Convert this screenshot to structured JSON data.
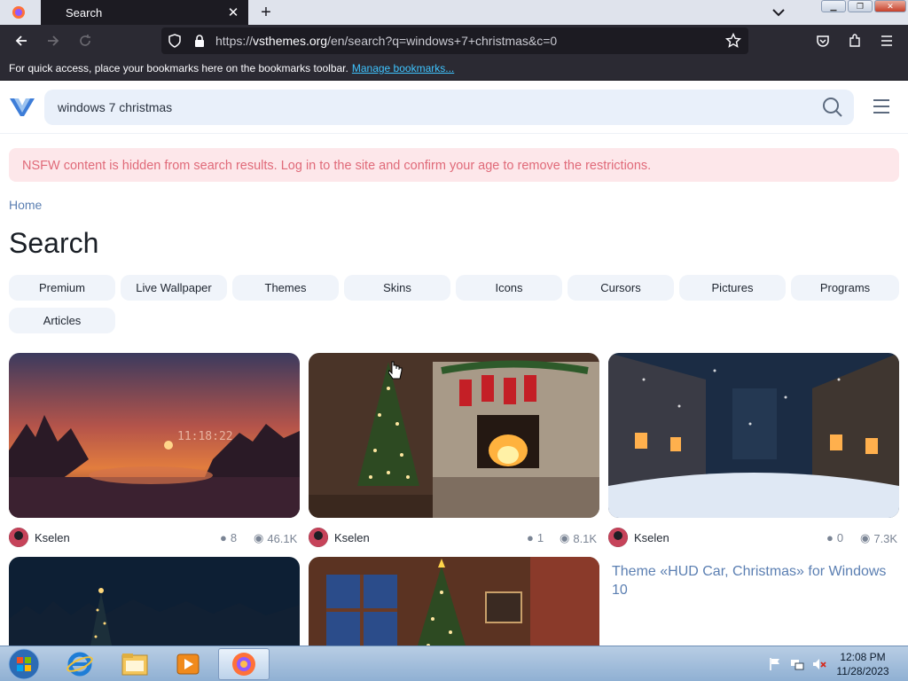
{
  "browser": {
    "tab_title": "Search",
    "url_prefix": "https://",
    "url_domain": "vsthemes.org",
    "url_path": "/en/search?q=windows+7+christmas&c=0",
    "bookmarks_message": "For quick access, place your bookmarks here on the bookmarks toolbar.",
    "manage_bookmarks_label": "Manage bookmarks..."
  },
  "site": {
    "search_value": "windows 7 christmas",
    "alert_text": "NSFW content is hidden from search results. Log in to the site and confirm your age to remove the restrictions.",
    "breadcrumb": "Home",
    "page_title": "Search",
    "categories": [
      "Premium",
      "Live Wallpaper",
      "Themes",
      "Skins",
      "Icons",
      "Cursors",
      "Pictures",
      "Programs",
      "Articles"
    ]
  },
  "results": [
    {
      "author": "Kselen",
      "comments": "8",
      "views": "46.1K",
      "image": "sunset-lake-clock-wallpaper"
    },
    {
      "author": "Kselen",
      "comments": "1",
      "views": "8.1K",
      "image": "christmas-fireplace-tree"
    },
    {
      "author": "Kselen",
      "comments": "0",
      "views": "7.3K",
      "image": "snowy-christmas-street"
    }
  ],
  "results_row2": [
    {
      "image": "night-forest-moon-tree"
    },
    {
      "image": "christmas-tree-window"
    }
  ],
  "theme_link": "Theme «HUD Car, Christmas» for Windows 10",
  "taskbar": {
    "time": "12:08 PM",
    "date": "11/28/2023"
  },
  "colors": {
    "accent": "#5b7fb2",
    "alert_bg": "#fde7ea",
    "alert_text": "#e06a79",
    "browser_dark": "#2b2a33"
  }
}
